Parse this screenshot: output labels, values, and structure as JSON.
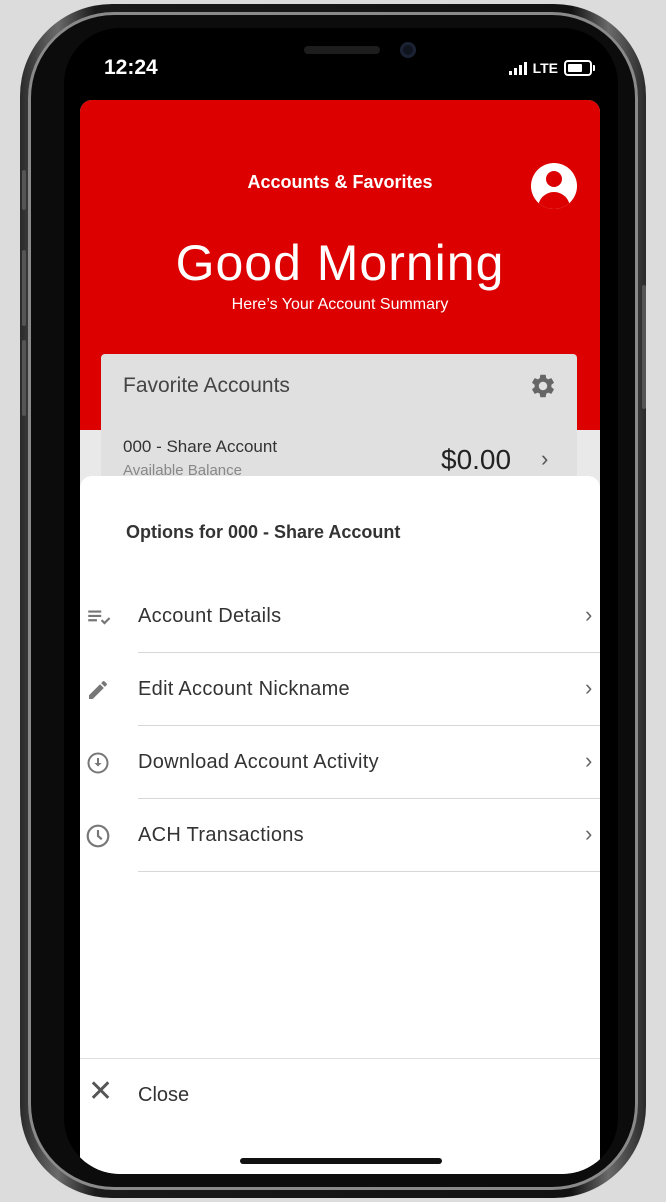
{
  "status": {
    "time": "12:24",
    "network": "LTE"
  },
  "header": {
    "title": "Accounts & Favorites",
    "greeting": "Good Morning",
    "subtitle": "Here’s Your Account Summary"
  },
  "favorites": {
    "title": "Favorite Accounts",
    "account": {
      "name": "000 - Share Account",
      "sub": "Available Balance",
      "balance": "$0.00"
    }
  },
  "sheet": {
    "title": "Options for 000 - Share Account",
    "items": [
      {
        "label": "Account Details",
        "icon": "list-check-icon"
      },
      {
        "label": "Edit Account Nickname",
        "icon": "pencil-icon"
      },
      {
        "label": "Download Account Activity",
        "icon": "download-circle-icon"
      },
      {
        "label": "ACH Transactions",
        "icon": "clock-icon"
      }
    ],
    "close_label": "Close"
  },
  "colors": {
    "brand": "#dc0000"
  }
}
